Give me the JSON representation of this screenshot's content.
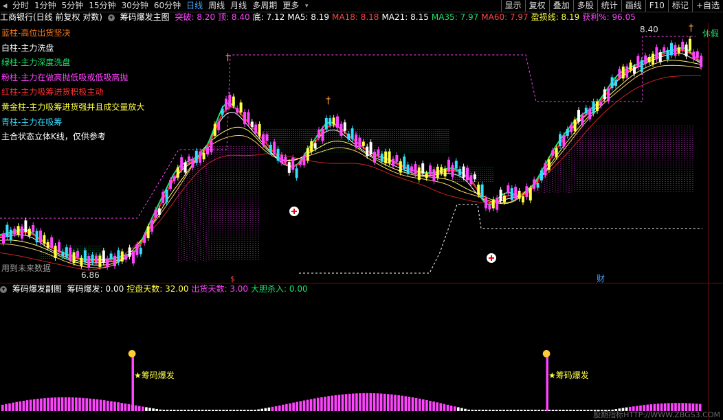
{
  "toolbar": {
    "left_arrow": "◀",
    "periods": [
      "分时",
      "1分钟",
      "5分钟",
      "15分钟",
      "30分钟",
      "60分钟",
      "日线",
      "周线",
      "月线",
      "多周期",
      "更多"
    ],
    "active_period": "日线",
    "more_suffix": "▾",
    "right_buttons": [
      "显示",
      "复权",
      "叠加",
      "多股",
      "统计",
      "画线",
      "F10",
      "标记",
      "+自选"
    ]
  },
  "main_header": {
    "stock": "工商银行(日线 前复权 对数)",
    "indicator": "筹码爆发主图",
    "items": [
      {
        "label": "突破: 8.20",
        "color": "#ff44ff"
      },
      {
        "label": "顶: 8.40",
        "color": "#ff44ff"
      },
      {
        "label": "底: 7.12",
        "color": "#ffffff"
      },
      {
        "label": "MA5: 8.19",
        "color": "#ffffff"
      },
      {
        "label": "MA18: 8.18",
        "color": "#ff4444"
      },
      {
        "label": "MA21: 8.15",
        "color": "#ffffff"
      },
      {
        "label": "MA35: 7.97",
        "color": "#19e36b"
      },
      {
        "label": "MA60: 7.97",
        "color": "#ff4444"
      },
      {
        "label": "盈损线: 8.19",
        "color": "#ffff44"
      },
      {
        "label": "获利%: 96.05",
        "color": "#ff44ff"
      }
    ],
    "right_icon": "◇"
  },
  "legend": [
    {
      "text": "蓝柱-高位出货坚决",
      "color": "#ff7a1a"
    },
    {
      "text": "白柱-主力洗盘",
      "color": "#ffffff"
    },
    {
      "text": "绿柱-主力深度洗盘",
      "color": "#19e36b"
    },
    {
      "text": "粉柱-主力在做高抛低吸或低吸高抛",
      "color": "#ff44ff"
    },
    {
      "text": "红柱-主力吸筹进货积极主动",
      "color": "#ff3333"
    },
    {
      "text": "黄金柱-主力吸筹进货强并且成交量放大",
      "color": "#ffff44"
    },
    {
      "text": "青柱-主力在吸筹",
      "color": "#33ddff"
    },
    {
      "text": "主合状态立体K线，仅供参考",
      "color": "#ffffff"
    }
  ],
  "main_labels": {
    "high": "8.40",
    "low": "6.86",
    "future": "用到未来数据",
    "holiday": "休假",
    "cai": "财",
    "dollar": "$"
  },
  "sub_header": {
    "indicator": "筹码爆发副图",
    "items": [
      {
        "label": "筹码爆发: 0.00",
        "color": "#ffffff"
      },
      {
        "label": "控盘天数: 32.00",
        "color": "#ffff44"
      },
      {
        "label": "出货天数: 3.00",
        "color": "#ff44ff"
      },
      {
        "label": "大胆杀入: 0.00",
        "color": "#19e36b"
      }
    ]
  },
  "sub_labels": {
    "burst1": "★筹码爆发",
    "burst2": "★筹码爆发"
  },
  "watermark": "股期指标HTTP://WWW.ZBGS3.COM",
  "colors": {
    "up": "#ff44ff",
    "down": "#33ddff",
    "ma5": "#ff2222",
    "ma_green": "#19e36b",
    "ma_yellow": "#ffff66",
    "ma_red2": "#cc2222",
    "box": "#ff44ff",
    "chip": "#19e36b"
  }
}
